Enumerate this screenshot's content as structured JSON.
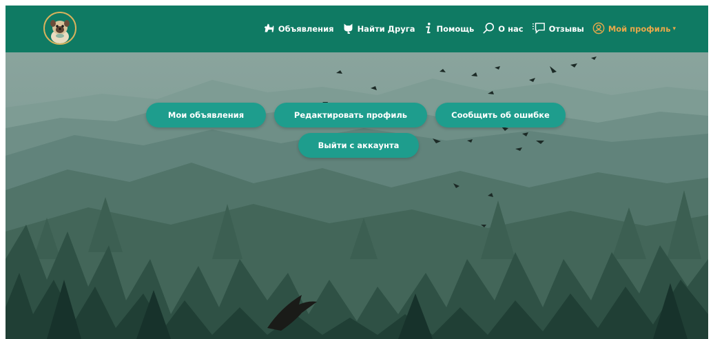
{
  "nav": {
    "items": [
      {
        "label": "Объявления",
        "icon": "dog-icon"
      },
      {
        "label": "Найти Друга",
        "icon": "cat-icon"
      },
      {
        "label": "Помощь",
        "icon": "info-icon"
      },
      {
        "label": "О нас",
        "icon": "search-icon"
      },
      {
        "label": "Отзывы",
        "icon": "chat-icon"
      }
    ],
    "profile": {
      "label": "Мой профиль",
      "icon": "user-circle-icon",
      "caret": "▾"
    }
  },
  "actions": {
    "my_ads": "Мои объявления",
    "edit_profile": "Редактировать профиль",
    "report_bug": "Сообщить об ошибке",
    "logout": "Выйти с аккаунта"
  },
  "colors": {
    "navbar": "#0f7a63",
    "accent": "#e9a84a",
    "button": "#1e9d8d"
  }
}
